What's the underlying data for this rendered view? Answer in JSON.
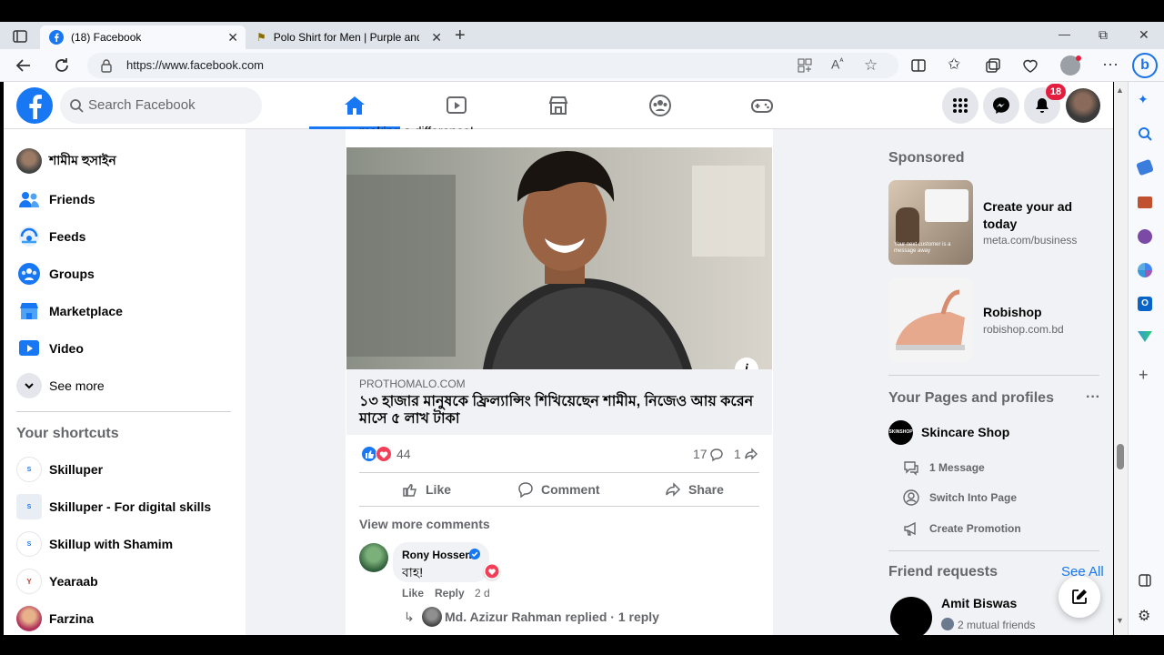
{
  "browser": {
    "tabs": [
      {
        "title": "(18) Facebook",
        "close": "✕"
      },
      {
        "title": "Polo Shirt for Men | Purple and B",
        "close": "✕"
      }
    ],
    "new_tab": "+",
    "url": "https://www.facebook.com",
    "window_controls": {
      "minimize": "—",
      "restore": "⧉",
      "close": "✕"
    }
  },
  "header": {
    "search_placeholder": "Search Facebook",
    "notification_badge": "18"
  },
  "left_sidebar": {
    "items": [
      {
        "label": "শামীম হুসাইন",
        "icon": "profile-avatar"
      },
      {
        "label": "Friends",
        "icon": "friends-icon"
      },
      {
        "label": "Feeds",
        "icon": "feeds-icon"
      },
      {
        "label": "Groups",
        "icon": "groups-icon"
      },
      {
        "label": "Marketplace",
        "icon": "marketplace-icon"
      },
      {
        "label": "Video",
        "icon": "video-icon"
      },
      {
        "label": "See more",
        "icon": "chevron-down-icon"
      }
    ],
    "shortcuts_title": "Your shortcuts",
    "shortcuts": [
      {
        "label": "Skilluper"
      },
      {
        "label": "Skilluper - For digital skills"
      },
      {
        "label": "Skillup with Shamim"
      },
      {
        "label": "Yearaab"
      },
      {
        "label": "Farzina"
      }
    ]
  },
  "post": {
    "caption_tail": "making a difference!",
    "link_source": "PROTHOMALO.COM",
    "link_title": "১৩ হাজার মানুষকে ফ্রিল্যান্সিং শিখিয়েছেন শামীম, নিজেও আয় করেন মাসে ৫ লাখ টাকা",
    "reaction_count": "44",
    "comment_count": "17",
    "share_count": "1",
    "actions": {
      "like": "Like",
      "comment": "Comment",
      "share": "Share"
    },
    "view_more_comments": "View more comments",
    "comment": {
      "author": "Rony Hossen",
      "text": "বাহ!",
      "like": "Like",
      "reply": "Reply",
      "time": "2 d"
    },
    "reply_summary": "Md. Azizur Rahman replied · 1 reply"
  },
  "right_sidebar": {
    "sponsored_title": "Sponsored",
    "ads": [
      {
        "title": "Create your ad today",
        "domain": "meta.com/business",
        "image_caption": "Your next customer is a message away"
      },
      {
        "title": "Robishop",
        "domain": "robishop.com.bd"
      }
    ],
    "pages_title": "Your Pages and profiles",
    "pages_more": "···",
    "page_name": "Skincare Shop",
    "page_actions": [
      {
        "label": "1 Message",
        "icon": "message-icon"
      },
      {
        "label": "Switch Into Page",
        "icon": "switch-profile-icon"
      },
      {
        "label": "Create Promotion",
        "icon": "megaphone-icon"
      }
    ],
    "friend_requests_title": "Friend requests",
    "see_all": "See All",
    "friend_request": {
      "name": "Amit Biswas",
      "mutual": "2 mutual friends"
    }
  },
  "colors": {
    "brand": "#1877f2",
    "page_bg": "#f0f2f5",
    "badge": "#e41e3f"
  }
}
